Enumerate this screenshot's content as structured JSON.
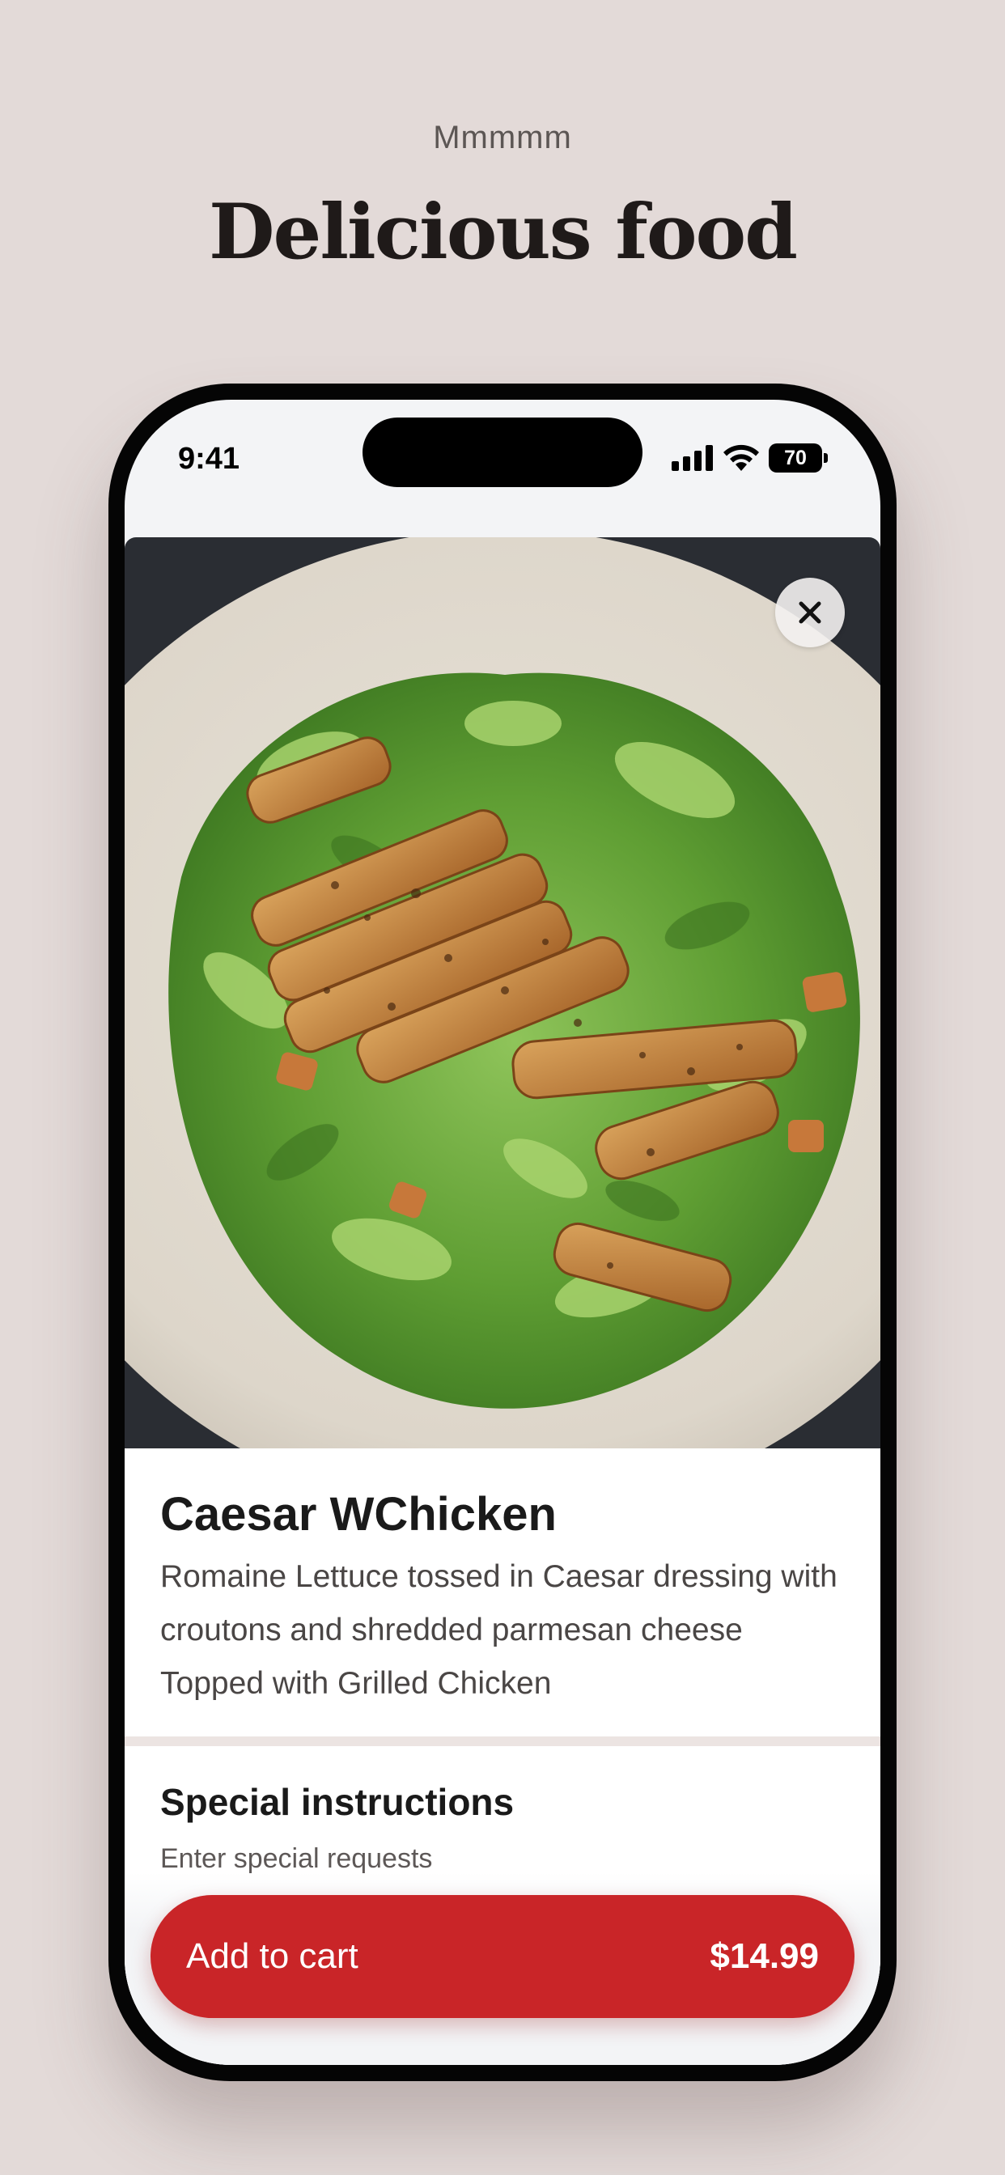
{
  "page": {
    "eyebrow": "Mmmmm",
    "headline": "Delicious food"
  },
  "status_bar": {
    "time": "9:41",
    "battery": "70"
  },
  "item": {
    "name": "Caesar WChicken",
    "description": "Romaine Lettuce tossed in Caesar dressing with croutons and shredded parmesan cheese Topped with Grilled Chicken",
    "photo_icon": "caesar-salad-photo"
  },
  "special_instructions": {
    "title": "Special instructions",
    "placeholder": "Enter special requests",
    "value": ""
  },
  "cart": {
    "button_label": "Add to cart",
    "price": "$14.99"
  },
  "colors": {
    "background": "#e3dad8",
    "accent": "#c92528",
    "text": "#1a1a1a"
  }
}
